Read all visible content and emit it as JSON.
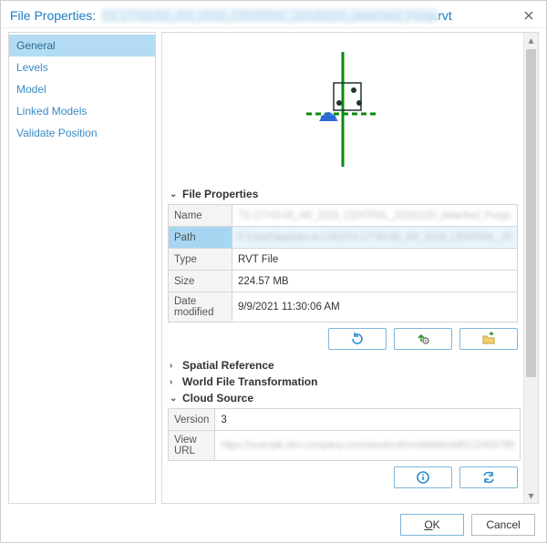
{
  "dialog": {
    "title_label": "File Properties:",
    "title_file_blur": "TS 17743-00_AR_2018_CENTRAL_20181120_detached_Purge",
    "title_ext": ".rvt"
  },
  "sidebar": {
    "items": [
      {
        "label": "General",
        "selected": true
      },
      {
        "label": "Levels",
        "selected": false
      },
      {
        "label": "Model",
        "selected": false
      },
      {
        "label": "Linked Models",
        "selected": false
      },
      {
        "label": "Validate Position",
        "selected": false
      }
    ]
  },
  "sections": {
    "file_properties": {
      "label": "File Properties",
      "expanded": true
    },
    "spatial_ref": {
      "label": "Spatial Reference",
      "expanded": false
    },
    "world_file": {
      "label": "World File Transformation",
      "expanded": false
    },
    "cloud_source": {
      "label": "Cloud Source",
      "expanded": true
    }
  },
  "file_props": {
    "name_label": "Name",
    "name_value": "TS-17743-00_AR_2018_CENTRAL_20181120_detached_Purge",
    "path_label": "Path",
    "path_value": "E:\\UserData\\Intro to CAD\\TS-17743-00_AR_2018_CENTRAL_20",
    "type_label": "Type",
    "type_value": "RVT File",
    "size_label": "Size",
    "size_value": "224.57 MB",
    "date_label": "Date modified",
    "date_value": "9/9/2021 11:30:06 AM"
  },
  "cloud_source": {
    "version_label": "Version",
    "version_value": "3",
    "viewurl_label": "View URL",
    "viewurl_value": "https://example.bim.company.com/view/revit/model/abcdef0123456789"
  },
  "footer": {
    "ok": "OK",
    "cancel": "Cancel"
  },
  "icons": {
    "close": "close-icon",
    "refresh": "refresh-icon",
    "gear_up": "gear-up-icon",
    "folder_open": "folder-open-icon",
    "info": "info-icon",
    "sync": "sync-icon"
  }
}
